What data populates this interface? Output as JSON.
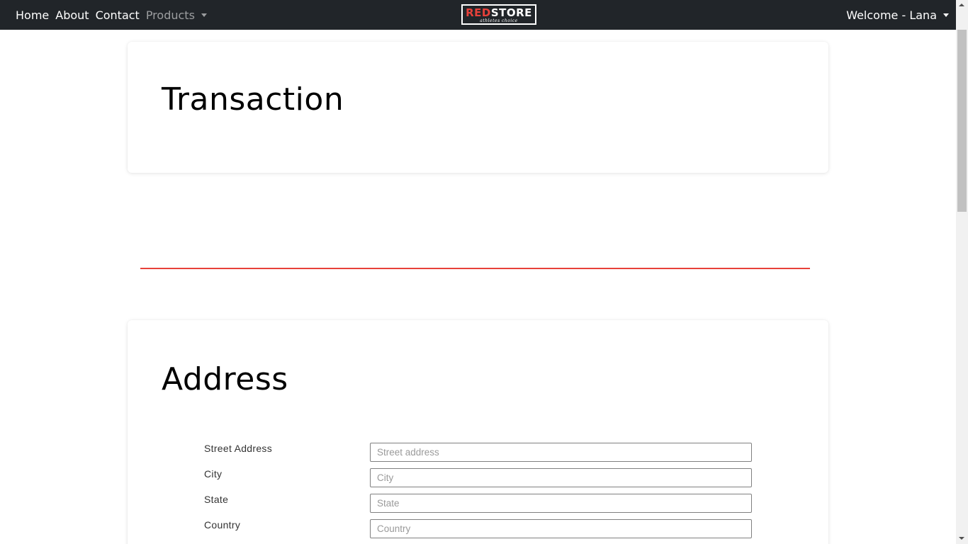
{
  "navbar": {
    "links": [
      "Home",
      "About",
      "Contact"
    ],
    "products_label": "Products",
    "brand": {
      "part1": "RED",
      "part2": "STORE",
      "tagline": "athletes choice"
    },
    "user_menu_label": "Welcome - Lana"
  },
  "transaction": {
    "title": "Transaction"
  },
  "address": {
    "title": "Address",
    "fields": [
      {
        "label": "Street Address",
        "placeholder": "Street address",
        "value": ""
      },
      {
        "label": "City",
        "placeholder": "City",
        "value": ""
      },
      {
        "label": "State",
        "placeholder": "State",
        "value": ""
      },
      {
        "label": "Country",
        "placeholder": "Country",
        "value": ""
      }
    ]
  },
  "colors": {
    "navbar_bg": "#212529",
    "accent_red": "#e8413a",
    "card_bg": "#ffffff"
  }
}
